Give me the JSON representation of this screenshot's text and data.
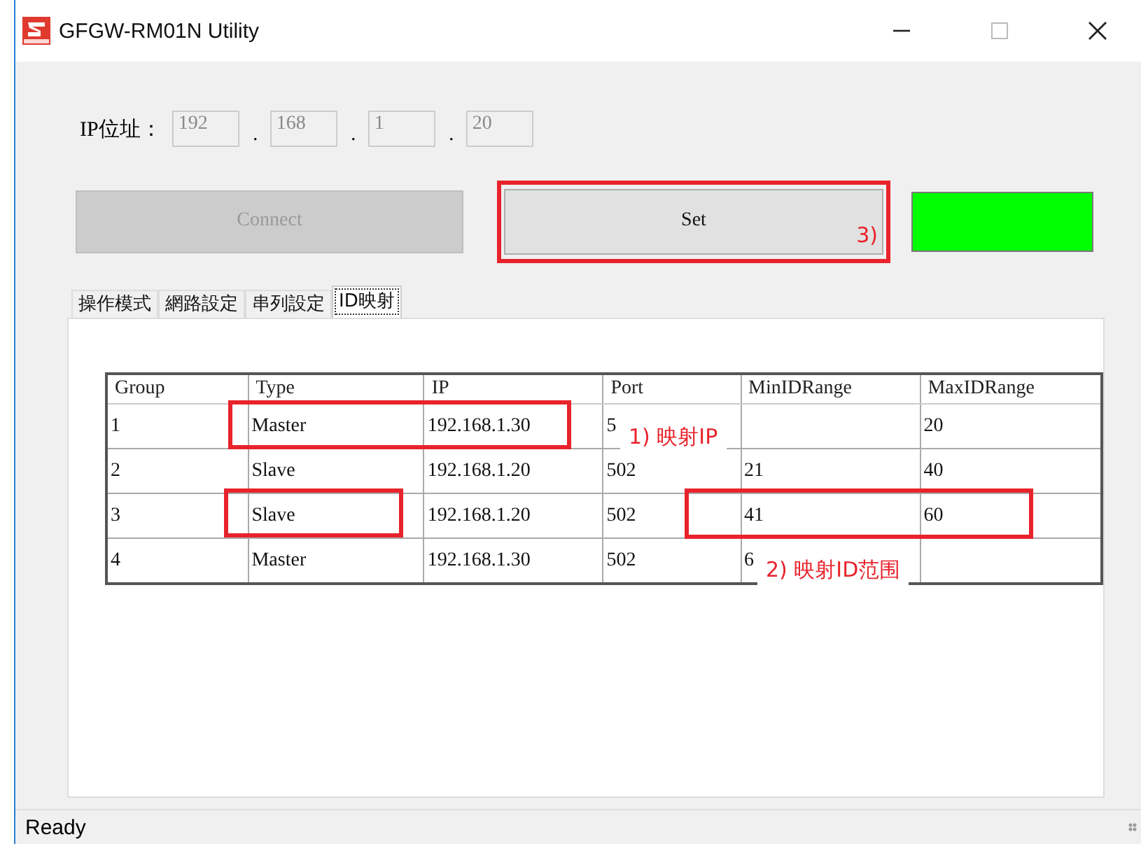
{
  "window": {
    "title": "GFGW-RM01N Utility"
  },
  "ip": {
    "label": "IP位址：",
    "separator": ".",
    "disabled": true,
    "octets": [
      "192",
      "168",
      "1",
      "20"
    ]
  },
  "buttons": [
    {
      "label": "Connect",
      "disabled": true
    },
    {
      "label": "Set",
      "disabled": false
    }
  ],
  "status_indicator": {
    "color": "#00ff00"
  },
  "annotations": [
    {
      "text": "3)"
    },
    {
      "text": "1) 映射IP"
    },
    {
      "text": "2) 映射ID范围"
    }
  ],
  "tabs": [
    {
      "label": "操作模式",
      "selected": false
    },
    {
      "label": "網路設定",
      "selected": false
    },
    {
      "label": "串列設定",
      "selected": false
    },
    {
      "label": "ID映射",
      "selected": true
    }
  ],
  "table": {
    "columns": [
      "Group",
      "Type",
      "IP",
      "Port",
      "MinIDRange",
      "MaxIDRange"
    ],
    "rows": [
      [
        "1",
        "Master",
        "192.168.1.30",
        "5",
        null,
        "20"
      ],
      [
        "2",
        "Slave",
        "192.168.1.20",
        "502",
        "21",
        "40"
      ],
      [
        "3",
        "Slave",
        "192.168.1.20",
        "502",
        "41",
        "60"
      ],
      [
        "4",
        "Master",
        "192.168.1.30",
        "502",
        "6",
        null
      ]
    ]
  },
  "status_bar": {
    "text": "Ready"
  }
}
